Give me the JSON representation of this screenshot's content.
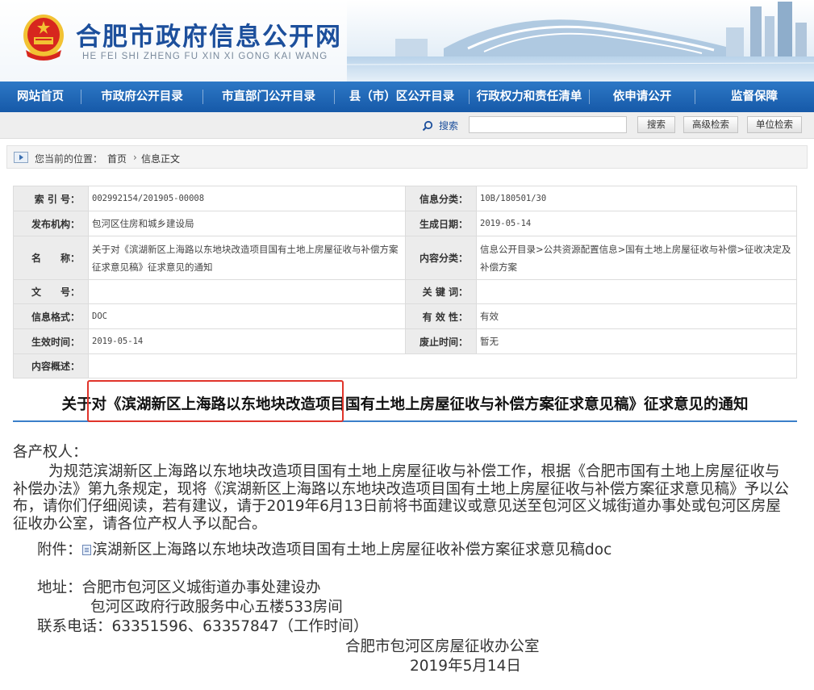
{
  "header": {
    "site_title": "合肥市政府信息公开网",
    "site_pinyin": "HE FEI SHI ZHENG FU XIN XI GONG KAI WANG"
  },
  "nav": [
    "网站首页",
    "市政府公开目录",
    "市直部门公开目录",
    "县（市）区公开目录",
    "行政权力和责任清单",
    "依申请公开",
    "监督保障"
  ],
  "search": {
    "label": "搜索",
    "placeholder": "",
    "value": "",
    "buttons": [
      "搜索",
      "高级检索",
      "单位检索"
    ]
  },
  "breadcrumb": {
    "label": "您当前的位置：",
    "items": [
      "首页",
      "信息正文"
    ],
    "separator": "›"
  },
  "meta": {
    "index_no_label": "索 引 号：",
    "index_no": "002992154/201905-00008",
    "category_label": "信息分类：",
    "category": "10B/180501/30",
    "publisher_label": "发布机构：",
    "publisher": "包河区住房和城乡建设局",
    "created_label": "生成日期：",
    "created": "2019-05-14",
    "name_label": "名　　称：",
    "name": "关于对《滨湖新区上海路以东地块改造项目国有土地上房屋征收与补偿方案征求意见稿》征求意见的通知",
    "topic_label": "内容分类：",
    "topic": "信息公开目录>公共资源配置信息>国有土地上房屋征收与补偿>征收决定及补偿方案",
    "doc_no_label": "文　　号：",
    "doc_no": "",
    "keywords_label": "关 键 词：",
    "keywords": "",
    "format_label": "信息格式：",
    "format": "DOC",
    "validity_label": "有 效 性：",
    "validity": "有效",
    "effective_label": "生效时间：",
    "effective": "2019-05-14",
    "repeal_label": "废止时间：",
    "repeal": "暂无",
    "summary_label": "内容概述：",
    "summary": ""
  },
  "article": {
    "title": "关于对《滨湖新区上海路以东地块改造项目国有土地上房屋征收与补偿方案征求意见稿》征求意见的通知",
    "salutation": "各产权人：",
    "paragraph": "为规范滨湖新区上海路以东地块改造项目国有土地上房屋征收与补偿工作，根据《合肥市国有土地上房屋征收与补偿办法》第九条规定，现将《滨湖新区上海路以东地块改造项目国有土地上房屋征收与补偿方案征求意见稿》予以公布，请你们仔细阅读，若有建议，请于2019年6月13日前将书面建议或意见送至包河区义城街道办事处或包河区房屋征收办公室，请各位产权人予以配合。",
    "attachment_label": "附件：",
    "attachment_name": "滨湖新区上海路以东地块改造项目国有土地上房屋征收补偿方案征求意见稿doc",
    "address_label": "地址：",
    "address_line1": "合肥市包河区义城街道办事处建设办",
    "address_line2": "包河区政府行政服务中心五楼533房间",
    "phone_label": "联系电话：",
    "phone": "63351596、63357847（工作时间）",
    "signature_org": "合肥市包河区房屋征收办公室",
    "signature_date": "2019年5月14日"
  },
  "colors": {
    "brand_blue": "#1c4f9c",
    "nav_blue": "#1659a8",
    "highlight_red": "#e0342a",
    "emblem_red": "#d7261e",
    "emblem_gold": "#f2c233"
  },
  "icons": [
    "national-emblem-icon",
    "search-icon",
    "breadcrumb-arrow-icon",
    "attachment-doc-icon"
  ]
}
